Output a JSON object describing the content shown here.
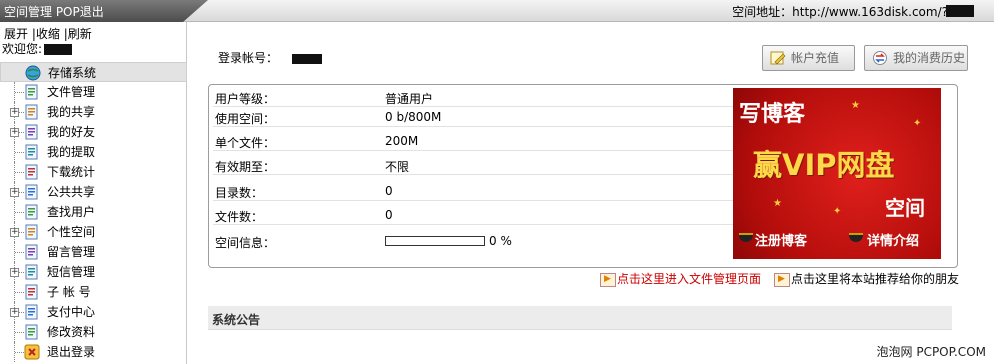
{
  "topbar": {
    "left_text": "空间管理 POP退出",
    "address_label": "空间地址：",
    "address_value": "http://www.163disk.com/?"
  },
  "sidebar": {
    "ops": [
      "展开",
      "收缩",
      "刷新"
    ],
    "ops_sep": "|",
    "welcome": "欢迎您:",
    "root": {
      "label": "存储系统",
      "icon": "globe-icon"
    },
    "items": [
      {
        "label": "文件管理",
        "icon": "file-icon",
        "expandable": false
      },
      {
        "label": "我的共享",
        "icon": "share-icon",
        "expandable": true
      },
      {
        "label": "我的好友",
        "icon": "friends-icon",
        "expandable": true
      },
      {
        "label": "我的提取",
        "icon": "extract-icon",
        "expandable": false
      },
      {
        "label": "下载统计",
        "icon": "stats-icon",
        "expandable": false
      },
      {
        "label": "公共共享",
        "icon": "public-share-icon",
        "expandable": true
      },
      {
        "label": "查找用户",
        "icon": "find-user-icon",
        "expandable": false
      },
      {
        "label": "个性空间",
        "icon": "space-icon",
        "expandable": true
      },
      {
        "label": "留言管理",
        "icon": "message-icon",
        "expandable": false
      },
      {
        "label": "短信管理",
        "icon": "sms-icon",
        "expandable": true
      },
      {
        "label": "子 帐 号",
        "icon": "sub-account-icon",
        "expandable": false
      },
      {
        "label": "支付中心",
        "icon": "payment-icon",
        "expandable": true
      },
      {
        "label": "修改资料",
        "icon": "edit-profile-icon",
        "expandable": false
      },
      {
        "label": "退出登录",
        "icon": "logout-icon",
        "expandable": false
      }
    ]
  },
  "main": {
    "account_label": "登录帐号：",
    "buttons": {
      "recharge": "帐户充值",
      "history": "我的消费历史"
    },
    "info": [
      {
        "key": "用户等级：",
        "value": "普通用户"
      },
      {
        "key": "使用空间：",
        "value": "0 b/800M"
      },
      {
        "key": "单个文件：",
        "value": "200M"
      },
      {
        "key": "有效期至：",
        "value": "不限"
      },
      {
        "key": "目录数：",
        "value": "0"
      },
      {
        "key": "文件数：",
        "value": "0"
      },
      {
        "key": "空间信息：",
        "value": "0 %"
      }
    ],
    "usage_fraction": 0,
    "ad": {
      "line1": "写博客",
      "line2": "赢VIP网盘",
      "line3": "空间",
      "btn1": "注册博客",
      "btn2": "详情介绍"
    },
    "link_files": "点击这里进入文件管理页面",
    "link_recommend": "点击这里将本站推荐给你的朋友",
    "notice_title": "系统公告"
  },
  "footer": "泡泡网 PCPOP.COM",
  "colors": {
    "link_red": "#cc0000",
    "ad_red": "#c8120f",
    "ad_gold": "#ffd84a"
  }
}
